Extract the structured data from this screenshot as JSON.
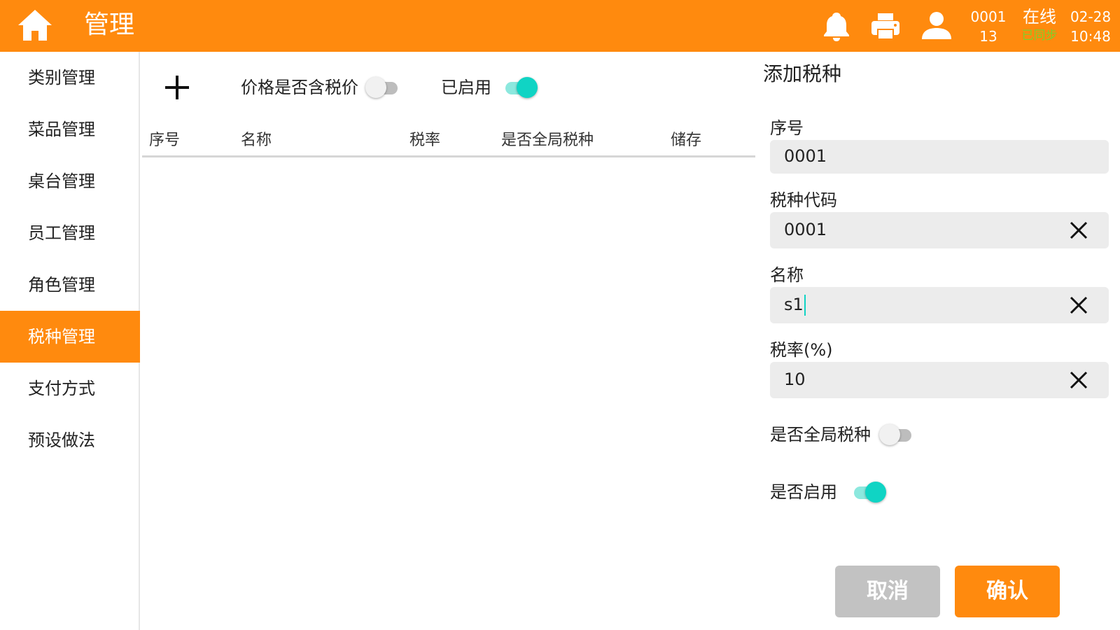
{
  "header": {
    "title": "管理",
    "terminal_id": "0001",
    "terminal_sub": "13",
    "status": "在线",
    "sync_status": "已同步",
    "date": "02-28",
    "time": "10:48",
    "accent_color": "#FF8A0E"
  },
  "icons": [
    "home-icon",
    "bell-icon",
    "printer-icon",
    "user-icon",
    "plus-icon",
    "close-icon"
  ],
  "sidebar": {
    "items": [
      {
        "label": "类别管理",
        "active": false
      },
      {
        "label": "菜品管理",
        "active": false
      },
      {
        "label": "桌台管理",
        "active": false
      },
      {
        "label": "员工管理",
        "active": false
      },
      {
        "label": "角色管理",
        "active": false
      },
      {
        "label": "税种管理",
        "active": true
      },
      {
        "label": "支付方式",
        "active": false
      },
      {
        "label": "预设做法",
        "active": false
      }
    ]
  },
  "list": {
    "price_includes_tax_label": "价格是否含税价",
    "price_includes_tax": false,
    "enabled_label": "已启用",
    "enabled": true,
    "columns": [
      "序号",
      "名称",
      "税率",
      "是否全局税种",
      "储存"
    ],
    "rows": []
  },
  "form": {
    "title": "添加税种",
    "seq_label": "序号",
    "seq_value": "0001",
    "code_label": "税种代码",
    "code_value": "0001",
    "name_label": "名称",
    "name_value": "s1",
    "rate_label": "税率(%)",
    "rate_value": "10",
    "global_label": "是否全局税种",
    "global": false,
    "enable_label": "是否启用",
    "enable": true,
    "cancel_label": "取消",
    "confirm_label": "确认"
  }
}
